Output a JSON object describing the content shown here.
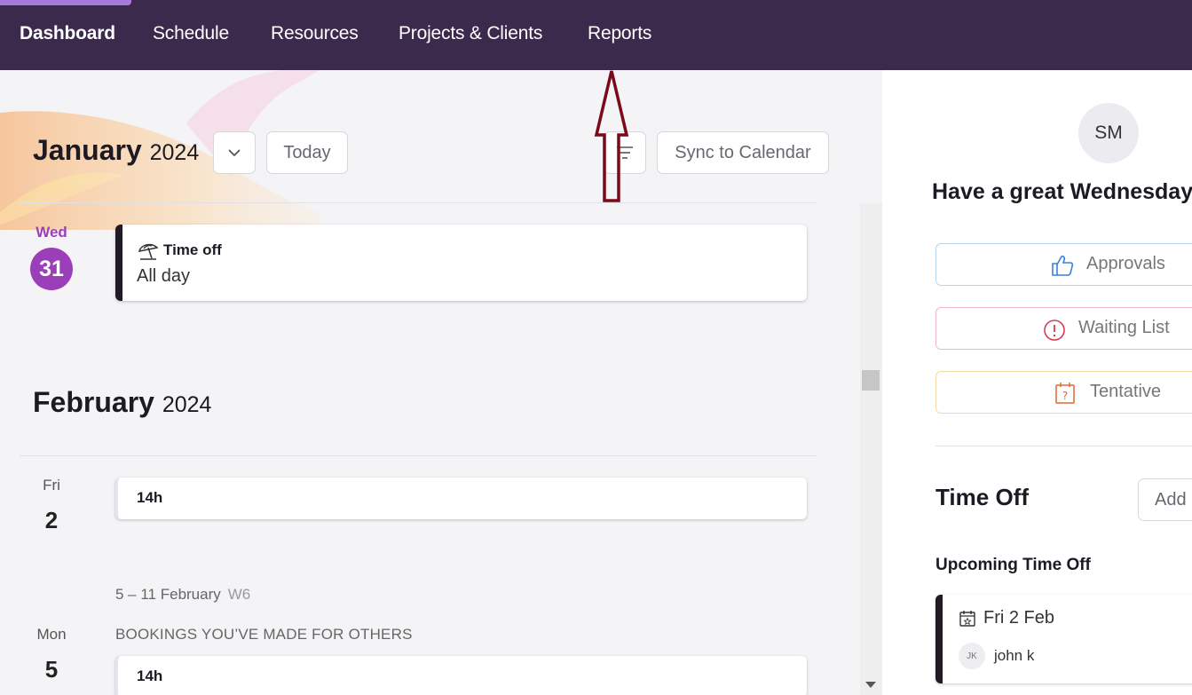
{
  "nav": {
    "items": [
      "Dashboard",
      "Schedule",
      "Resources",
      "Projects & Clients",
      "Reports"
    ],
    "active": "Dashboard"
  },
  "calendar": {
    "current_month": "January",
    "current_year": "2024",
    "today_button": "Today",
    "sync_button": "Sync to Calendar",
    "today_day_label": "Wed",
    "today_day_num": "31",
    "today_card": {
      "title": "Time off",
      "subtitle": "All day"
    },
    "next_month": "February",
    "next_year": "2024",
    "days": [
      {
        "label": "Fri",
        "num": "2",
        "card_text": "14h"
      },
      {
        "label": "Mon",
        "num": "5",
        "card_text": "14h"
      }
    ],
    "week_range": "5 – 11 February",
    "week_number": "W6",
    "bookings_heading": "BOOKINGS YOU’VE MADE FOR OTHERS"
  },
  "sidebar": {
    "avatar_initials": "SM",
    "greeting": "Have a great Wednesday",
    "approvals_label": "Approvals",
    "waiting_list_label": "Waiting List",
    "tentative_label": "Tentative",
    "time_off_title": "Time Off",
    "add_button": "Add",
    "upcoming_title": "Upcoming Time Off",
    "upcoming_item": {
      "date": "Fri 2 Feb",
      "initials": "JK",
      "person": "john k"
    }
  },
  "colors": {
    "nav_bg": "#3b2a4c",
    "today_badge": "#9b3fb8",
    "approvals_border": "#b9d6f0",
    "waiting_border": "#f3b9c6",
    "tentative_border": "#f3d9a4",
    "annotation_arrow": "#7a0a1a"
  }
}
